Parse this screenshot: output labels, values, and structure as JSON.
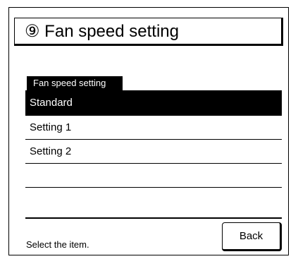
{
  "screen": {
    "title": "⑨ Fan speed setting"
  },
  "section": {
    "label": "Fan speed setting"
  },
  "list": {
    "items": [
      {
        "label": "Standard",
        "selected": true
      },
      {
        "label": "Setting 1",
        "selected": false
      },
      {
        "label": "Setting 2",
        "selected": false
      },
      {
        "label": "",
        "selected": false
      },
      {
        "label": "",
        "selected": false
      }
    ]
  },
  "footer": {
    "status": "Select the item.",
    "back_label": "Back"
  },
  "colors": {
    "selected_bg": "#000000",
    "selected_text": "#ffffff",
    "text": "#000000",
    "background": "#ffffff"
  }
}
